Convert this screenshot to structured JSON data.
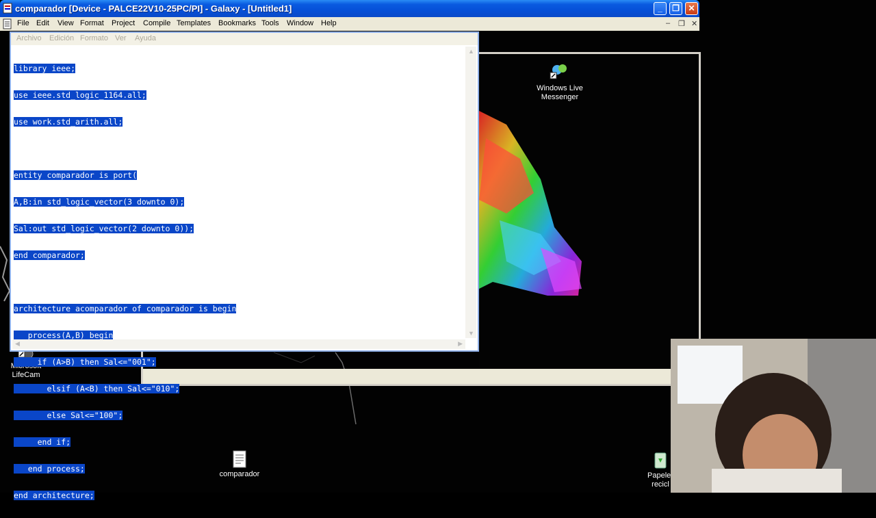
{
  "window": {
    "title": "comparador [Device - PALCE22V10-25PC/PI] - Galaxy - [Untitled1]",
    "buttons": {
      "minimize": "_",
      "maximize": "❐",
      "close": "✕"
    }
  },
  "menu": {
    "items": [
      "File",
      "Edit",
      "View",
      "Format",
      "Project",
      "Compile",
      "Templates",
      "Bookmarks",
      "Tools",
      "Window",
      "Help"
    ],
    "mdi_minimize": "–",
    "mdi_restore": "❐",
    "mdi_close": "✕"
  },
  "editor": {
    "menu": [
      "Archivo",
      "Edición",
      "Formato",
      "Ver",
      "Ayuda"
    ],
    "lines": [
      "library ieee;",
      "use ieee.std_logic_1164.all;",
      "use work.std_arith.all;",
      "",
      "entity comparador is port(",
      "A,B:in std_logic_vector(3 downto 0);",
      "Sal:out std_logic_vector(2 downto 0));",
      "end comparador;",
      "",
      "architecture acomparador of comparador is begin",
      "   process(A,B) begin",
      "     if (A>B) then Sal<=\"001\";",
      "       elsif (A<B) then Sal<=\"010\";",
      "       else Sal<=\"100\";",
      "     end if;",
      "   end process;",
      "end architecture;"
    ],
    "selection_color": "#0a46c8"
  },
  "desktop": {
    "icons": {
      "messenger": "Windows Live Messenger",
      "lifecam_line1": "Microsoft",
      "lifecam_line2": "LifeCam",
      "comparador": "comparador",
      "recycle_line1": "Papeler",
      "recycle_line2": "recicl"
    }
  },
  "colors": {
    "titlebar": "#0a5be0",
    "menubar": "#ece9d8",
    "desktop": "#020202"
  }
}
